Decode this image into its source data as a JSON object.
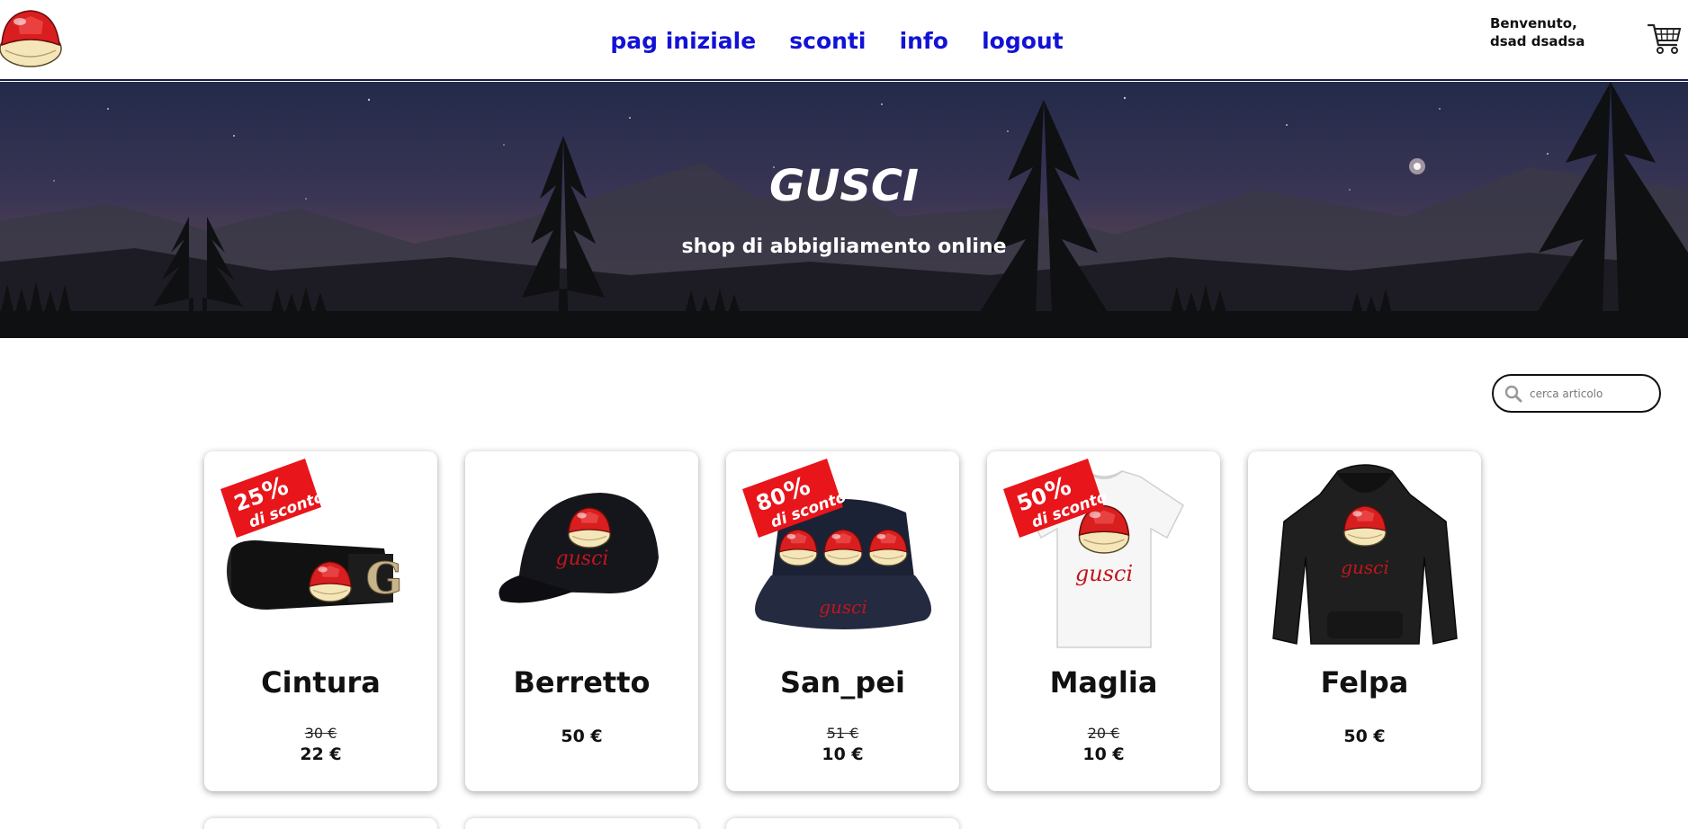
{
  "header": {
    "logo_icon": "red-shell-logo-icon",
    "nav": [
      "pag iniziale",
      "sconti",
      "info",
      "logout"
    ],
    "welcome_line1": "Benvenuto,",
    "welcome_line2": "dsad dsadsa",
    "cart_icon": "shopping-cart-icon"
  },
  "hero": {
    "title": "GUSCI",
    "subtitle": "shop di abbigliamento online"
  },
  "search": {
    "placeholder": "cerca articolo",
    "value": ""
  },
  "colors": {
    "nav_link": "#1212d6",
    "badge": "#e8151b",
    "shell_red": "#d81e1e"
  },
  "products": [
    {
      "name": "Cintura",
      "discount_number": "25",
      "discount_pct": "%",
      "discount_label": "di sconto",
      "old_price": "30 €",
      "price": "22 €",
      "image": "belt-image"
    },
    {
      "name": "Berretto",
      "price": "50 €",
      "image": "cap-image"
    },
    {
      "name": "San_pei",
      "discount_number": "80",
      "discount_pct": "%",
      "discount_label": "di sconto",
      "old_price": "51 €",
      "price": "10 €",
      "image": "bucket-hat-image"
    },
    {
      "name": "Maglia",
      "discount_number": "50",
      "discount_pct": "%",
      "discount_label": "di sconto",
      "old_price": "20 €",
      "price": "10 €",
      "image": "tshirt-image"
    },
    {
      "name": "Felpa",
      "price": "50 €",
      "image": "hoodie-image"
    }
  ],
  "brand_print": "gusci"
}
